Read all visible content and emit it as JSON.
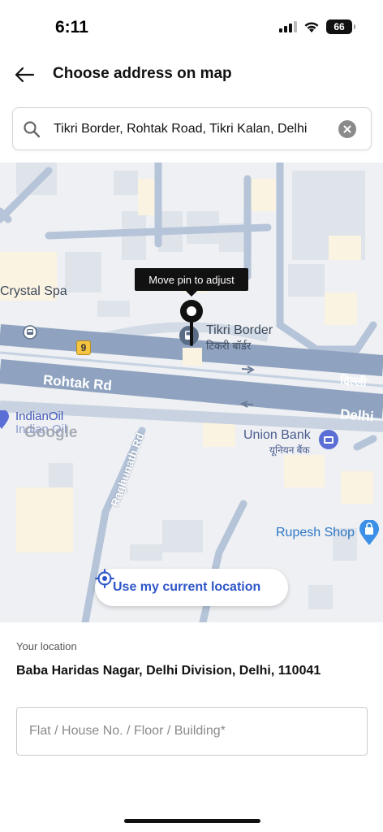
{
  "status_bar": {
    "time": "6:11",
    "battery": "66"
  },
  "header": {
    "title": "Choose address on map"
  },
  "search": {
    "value": "Tikri Border, Rohtak Road, Tikri Kalan, Delhi"
  },
  "map": {
    "tooltip": "Move pin to adjust",
    "labels": {
      "crystal_spa": "Crystal Spa",
      "tikri_border": "Tikri Border",
      "tikri_border_hindi": "टिकरी बॉर्डर",
      "route_marker": "9",
      "rohtak_rd": "Rohtak Rd",
      "delhi_hindi": "दिल्ली",
      "delhi": "Delhi",
      "indian_oil_1": "IndianOil",
      "indian_oil_2": "Indian Oil",
      "google": "Google",
      "union_bank": "Union Bank",
      "union_bank_hindi": "यूनियन बैंक",
      "raghunath_rd": "Raghunath Rd",
      "rupesh_shop": "Rupesh Shop"
    },
    "current_location_label": "Use my current location"
  },
  "location": {
    "label": "Your location",
    "address": "Baba Haridas Nagar, Delhi Division, Delhi, 110041"
  },
  "flat_field": {
    "placeholder": "Flat / House No. / Floor / Building*"
  },
  "colors": {
    "accent": "#2e56c8",
    "road": "#8fa3c0",
    "map_bg": "#eef0f3"
  }
}
